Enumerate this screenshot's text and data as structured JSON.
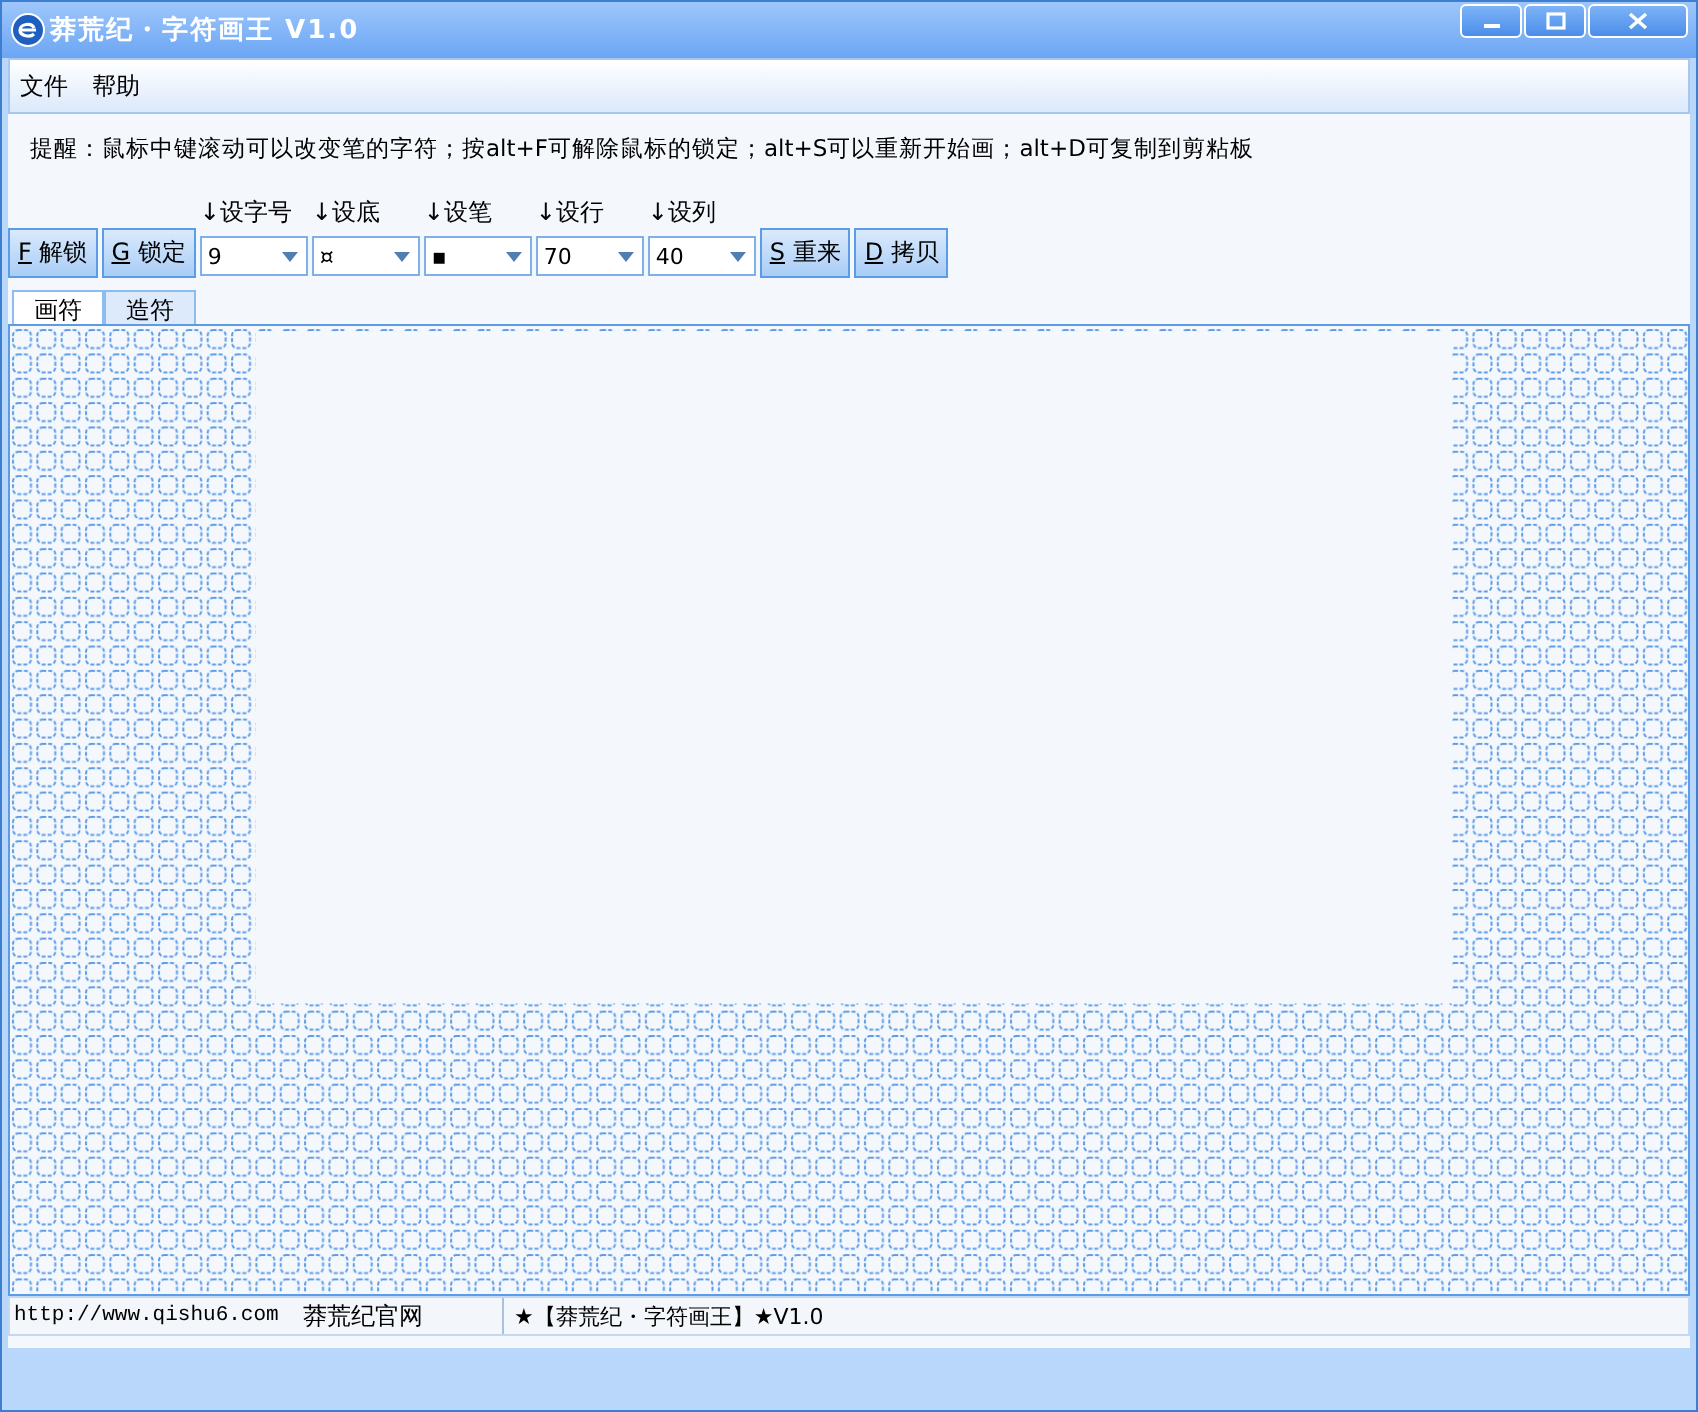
{
  "window": {
    "title": "莽荒纪・字符画王 V1.0"
  },
  "menu": [
    "文件",
    "帮助"
  ],
  "hint": "提醒：鼠标中键滚动可以改变笔的字符；按alt+F可解除鼠标的锁定；alt+S可以重新开始画；alt+D可复制到剪粘板",
  "left_buttons": [
    {
      "key": "F",
      "label": "解锁"
    },
    {
      "key": "G",
      "label": "锁定"
    }
  ],
  "fields": [
    {
      "label": "↓设字号",
      "value": "9"
    },
    {
      "label": "↓设底",
      "value": "¤"
    },
    {
      "label": "↓设笔",
      "value": "▪"
    },
    {
      "label": "↓设行",
      "value": "70"
    },
    {
      "label": "↓设列",
      "value": "40"
    }
  ],
  "right_buttons": [
    {
      "key": "S",
      "label": "重来"
    },
    {
      "key": "D",
      "label": "拷贝"
    }
  ],
  "tabs": [
    {
      "label": "画符",
      "selected": true
    },
    {
      "label": "造符",
      "selected": false
    }
  ],
  "status_bar": {
    "url": "http://www.qishu6.com",
    "site": "莽荒纪官网",
    "version": "★【莽荒纪・字符画王】★V1.0"
  }
}
